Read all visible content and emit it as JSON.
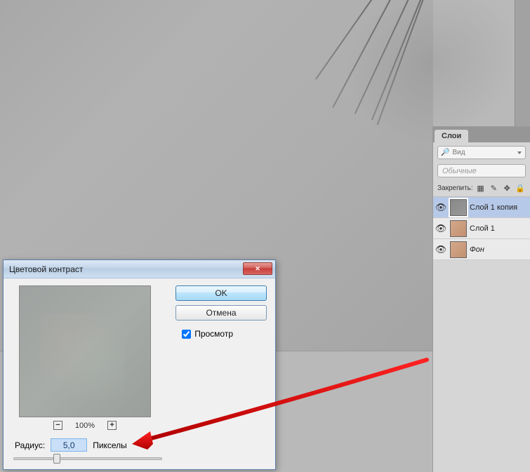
{
  "dialog": {
    "title": "Цветовой контраст",
    "ok_label": "OK",
    "cancel_label": "Отмена",
    "preview_label": "Просмотр",
    "preview_checked": true,
    "zoom_level": "100%",
    "radius_label": "Радиус:",
    "radius_value": "5,0",
    "radius_unit": "Пикселы"
  },
  "layers_panel": {
    "tab_label": "Слои",
    "kind_placeholder": "Вид",
    "blend_mode": "Обычные",
    "lock_label": "Закрепить:",
    "layers": [
      {
        "name": "Слой 1 копия",
        "selected": true,
        "italic": false,
        "thumb": "gray"
      },
      {
        "name": "Слой 1",
        "selected": false,
        "italic": false,
        "thumb": "skin"
      },
      {
        "name": "Фон",
        "selected": false,
        "italic": true,
        "thumb": "skin"
      }
    ]
  },
  "icons": {
    "search": "🔎",
    "minus": "−",
    "plus": "+",
    "eye": "👁",
    "checker": "▦",
    "brush": "✎",
    "move": "✥",
    "lock": "🔒",
    "close_x": "✕"
  }
}
